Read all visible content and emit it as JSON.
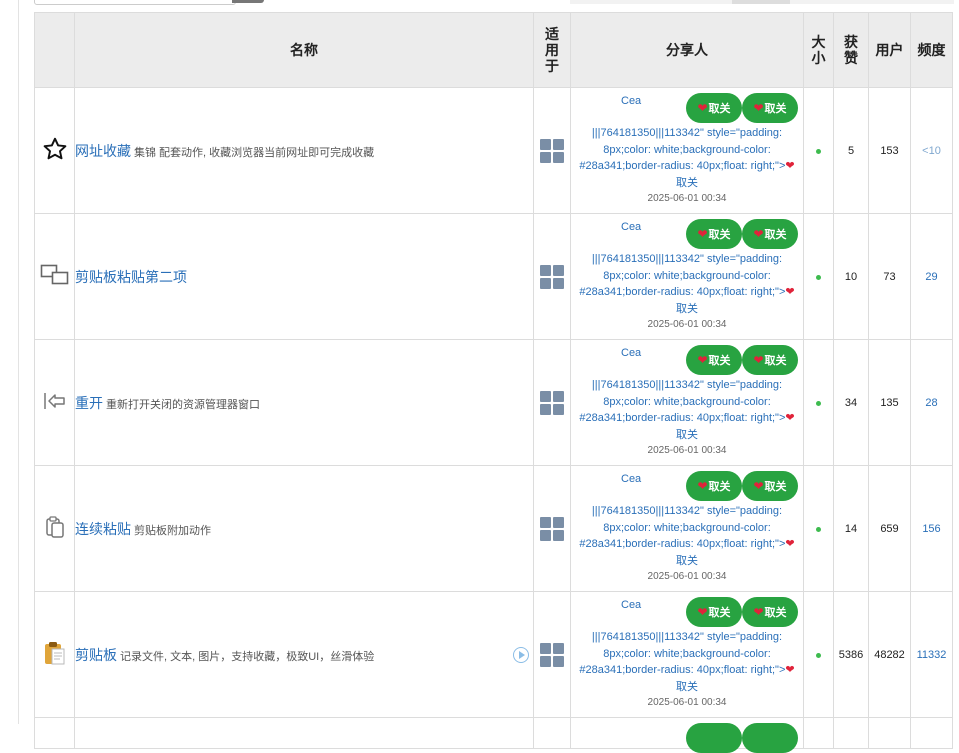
{
  "headers": {
    "name": "名称",
    "platform": "适用于",
    "sharer": "分享人",
    "size": "大小",
    "likes": "获赞",
    "users": "用户",
    "freq": "频度"
  },
  "buttons": {
    "pill_label": "取关",
    "heart_glyph": "❤"
  },
  "share": {
    "sharer": "Cea",
    "raw_text": "|||764181350|||113342\" style=\"padding: 8px;color: white;background-color: #28a341;border-radius: 40px;float: right;\">",
    "trailing_label": "取关",
    "date": "2025-06-01 00:34"
  },
  "rows": [
    {
      "icon": "star-icon",
      "title": "网址收藏",
      "desc": "集锦 配套动作, 收藏浏览器当前网址即可完成收藏",
      "size_dot": "●",
      "likes": "5",
      "users": "153",
      "freq": "<10"
    },
    {
      "icon": "windows-icon",
      "title": "剪贴板粘贴第二项",
      "desc": "",
      "size_dot": "●",
      "likes": "10",
      "users": "73",
      "freq": "29"
    },
    {
      "icon": "back-icon",
      "title": "重开",
      "desc": "重新打开关闭的资源管理器窗口",
      "size_dot": "●",
      "likes": "34",
      "users": "135",
      "freq": "28"
    },
    {
      "icon": "copy-icon",
      "title": "连续粘贴",
      "desc": "剪贴板附加动作",
      "size_dot": "●",
      "likes": "14",
      "users": "659",
      "freq": "156"
    },
    {
      "icon": "clipboard-icon",
      "title": "剪贴板",
      "desc": "记录文件, 文本, 图片，支持收藏，极致UI，丝滑体验",
      "size_dot": "●",
      "likes": "5386",
      "users": "48282",
      "freq": "11332"
    }
  ],
  "colors": {
    "accent_green": "#28a341",
    "link_blue": "#2a6fb8",
    "heart_red": "#e0233a",
    "header_bg": "#ececec"
  }
}
